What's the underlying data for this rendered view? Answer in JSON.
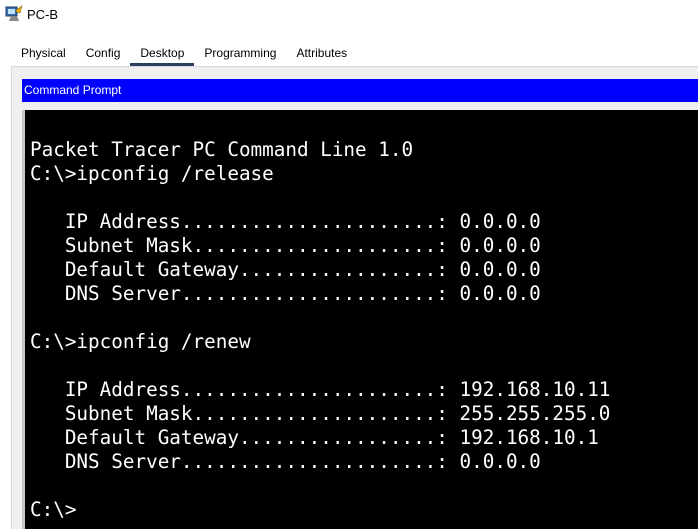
{
  "window": {
    "title": "PC-B",
    "icon": "pc-terminal-icon"
  },
  "tabs": [
    {
      "label": "Physical",
      "active": false
    },
    {
      "label": "Config",
      "active": false
    },
    {
      "label": "Desktop",
      "active": true
    },
    {
      "label": "Programming",
      "active": false
    },
    {
      "label": "Attributes",
      "active": false
    }
  ],
  "command_prompt": {
    "header_label": "Command Prompt",
    "lines": [
      "Packet Tracer PC Command Line 1.0",
      "C:\\>ipconfig /release",
      "",
      "   IP Address......................: 0.0.0.0",
      "   Subnet Mask.....................: 0.0.0.0",
      "   Default Gateway.................: 0.0.0.0",
      "   DNS Server......................: 0.0.0.0",
      "",
      "C:\\>ipconfig /renew",
      "",
      "   IP Address......................: 192.168.10.11",
      "   Subnet Mask.....................: 255.255.255.0",
      "   Default Gateway.................: 192.168.10.1",
      "   DNS Server......................: 0.0.0.0",
      "",
      "C:\\>"
    ]
  },
  "colors": {
    "header_bg": "#0000ff",
    "terminal_bg": "#000000",
    "terminal_fg": "#ffffff",
    "active_tab_underline": "#2a3f5f"
  }
}
